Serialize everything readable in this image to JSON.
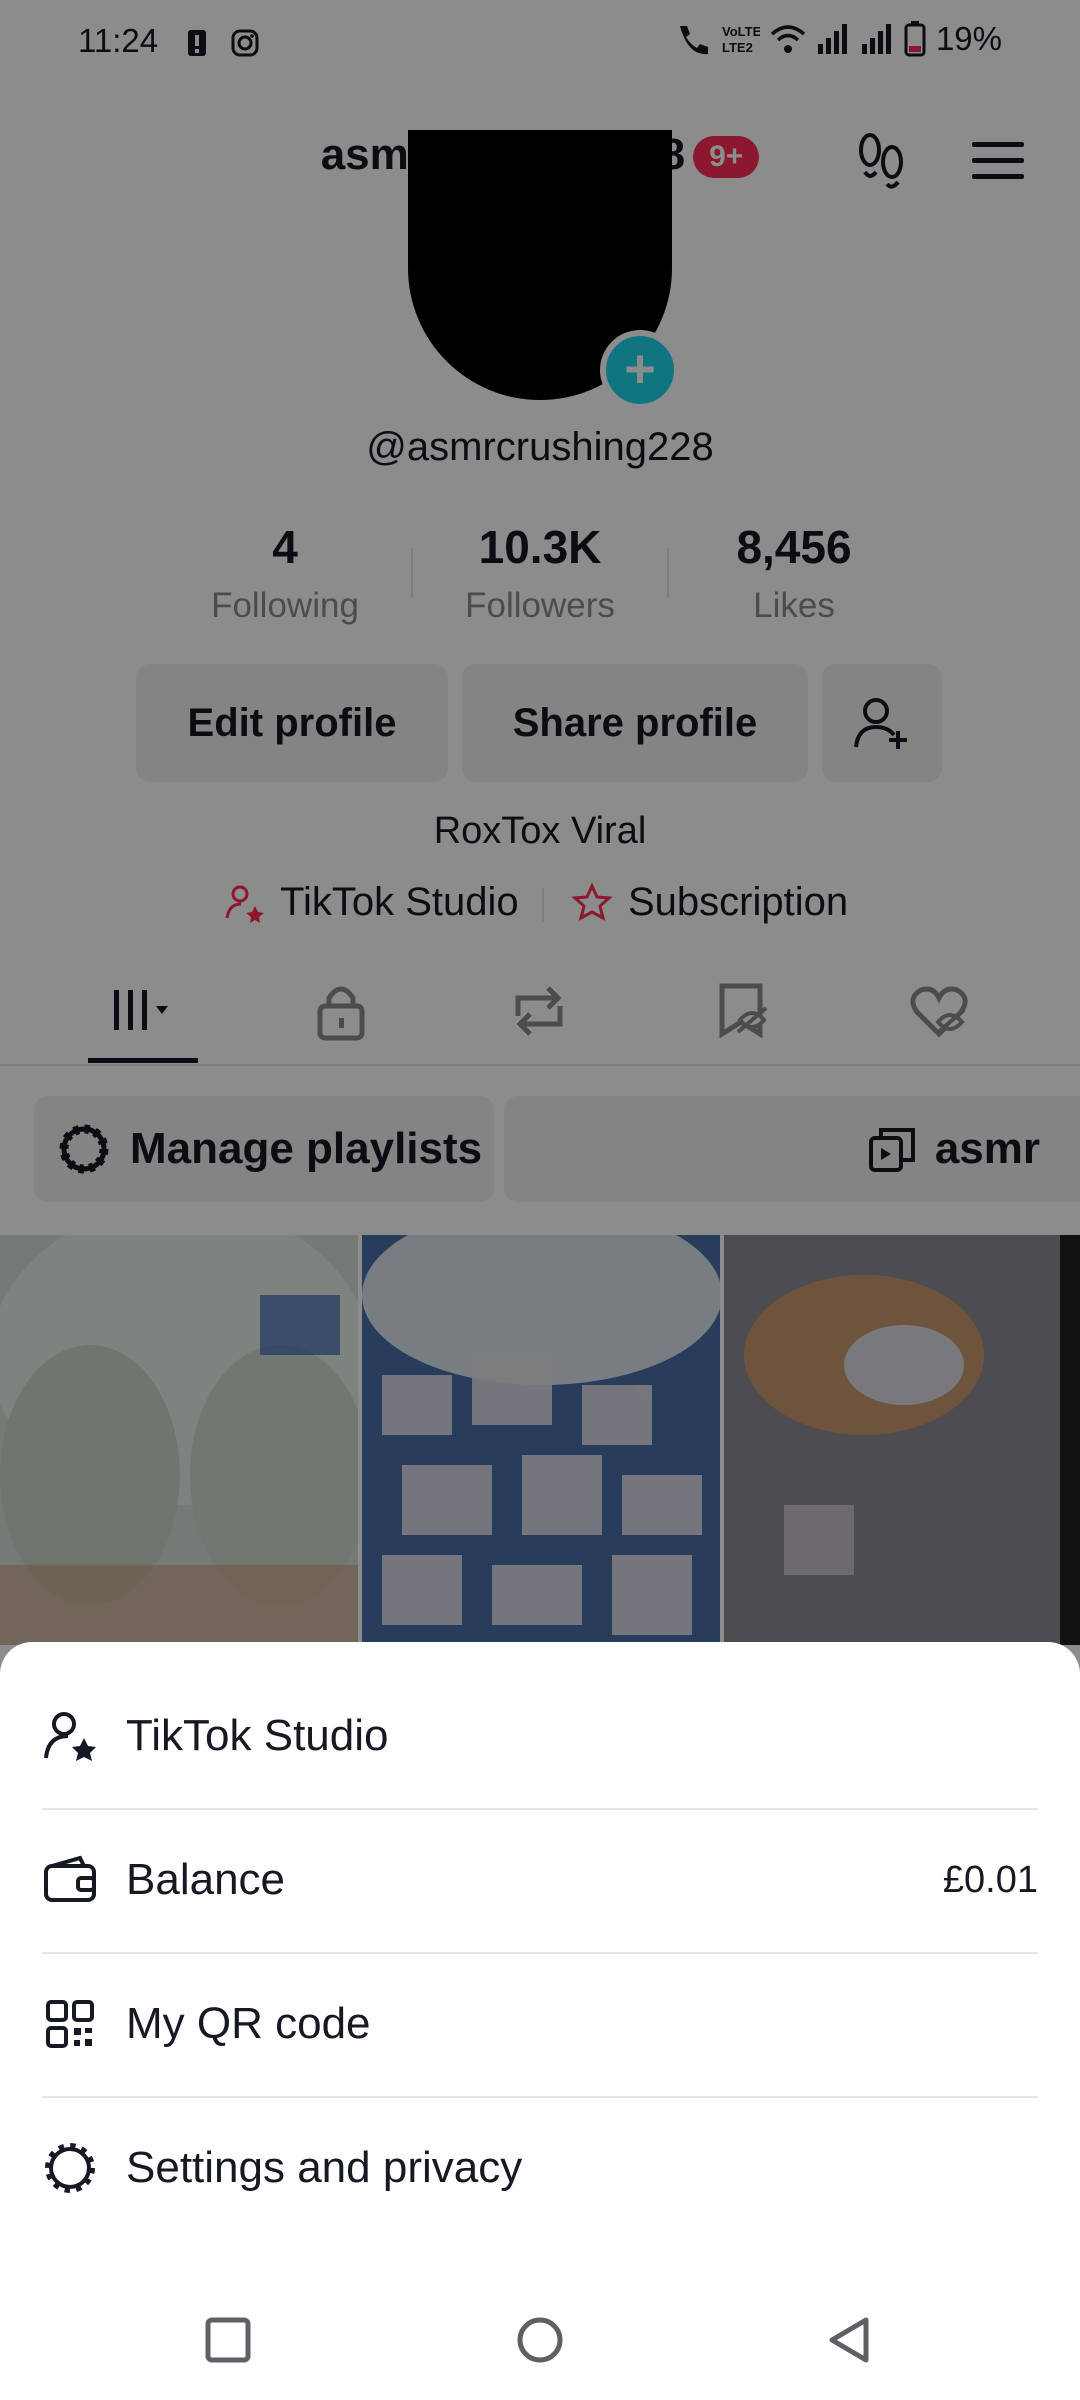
{
  "status_bar": {
    "time": "11:24",
    "battery": "19%"
  },
  "header": {
    "username": "asmrcrushing228",
    "notification_badge": "9+"
  },
  "profile": {
    "handle": "@asmrcrushing228",
    "stats": [
      {
        "value": "4",
        "label": "Following"
      },
      {
        "value": "10.3K",
        "label": "Followers"
      },
      {
        "value": "8,456",
        "label": "Likes"
      }
    ],
    "edit_label": "Edit profile",
    "share_label": "Share profile",
    "bio": "RoxTox Viral",
    "studio_link": "TikTok Studio",
    "subscription_link": "Subscription"
  },
  "playlists": {
    "manage_label": "Manage playlists",
    "playlist_name": "asmr"
  },
  "menu": {
    "items": [
      {
        "label": "TikTok Studio",
        "icon": "person-star-icon",
        "value": ""
      },
      {
        "label": "Balance",
        "icon": "wallet-icon",
        "value": "£0.01"
      },
      {
        "label": "My QR code",
        "icon": "qr-code-icon",
        "value": ""
      },
      {
        "label": "Settings and privacy",
        "icon": "gear-icon",
        "value": ""
      }
    ]
  },
  "colors": {
    "accent": "#fe2c55",
    "avatar_plus": "#20d5ec",
    "text": "#161823",
    "secondary_text": "#8a8b91"
  }
}
